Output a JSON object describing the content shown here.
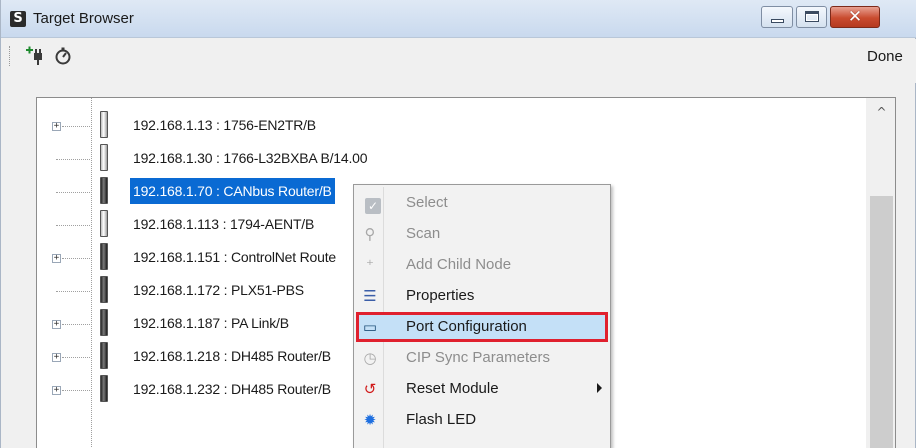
{
  "window": {
    "title": "Target Browser",
    "app_icon_glyph": "S",
    "close_glyph": "✕"
  },
  "toolbar": {
    "add_device_icon": "plug-add-icon",
    "refresh_icon": "refresh-icon",
    "done_label": "Done"
  },
  "tree": {
    "scroll_up_glyph": "^",
    "rows": [
      {
        "label": "192.168.1.13 : 1756-EN2TR/B",
        "expandable": true,
        "device_style": "light"
      },
      {
        "label": "192.168.1.30 : 1766-L32BXBA B/14.00",
        "expandable": false,
        "device_style": "light"
      },
      {
        "label": "192.168.1.70 : CANbus Router/B",
        "expandable": false,
        "device_style": "dark",
        "selected": true
      },
      {
        "label": "192.168.1.113 : 1794-AENT/B",
        "expandable": false,
        "device_style": "light"
      },
      {
        "label": "192.168.1.151 : ControlNet Route",
        "expandable": true,
        "device_style": "dark"
      },
      {
        "label": "192.168.1.172 : PLX51-PBS",
        "expandable": false,
        "device_style": "dark"
      },
      {
        "label": "192.168.1.187 : PA Link/B",
        "expandable": true,
        "device_style": "dark"
      },
      {
        "label": "192.168.1.218 : DH485 Router/B",
        "expandable": true,
        "device_style": "dark"
      },
      {
        "label": "192.168.1.232 : DH485 Router/B",
        "expandable": true,
        "device_style": "dark"
      }
    ]
  },
  "context_menu": {
    "items": [
      {
        "label": "Select",
        "icon": "checkmark-icon",
        "glyph": "✓",
        "enabled": false
      },
      {
        "label": "Scan",
        "icon": "magnifier-icon",
        "glyph": "⚲",
        "enabled": false
      },
      {
        "label": "Add Child Node",
        "icon": "add-node-icon",
        "glyph": "⁺",
        "enabled": false
      },
      {
        "label": "Properties",
        "icon": "list-icon",
        "glyph": "☰",
        "enabled": true
      },
      {
        "label": "Port Configuration",
        "icon": "monitor-icon",
        "glyph": "▭",
        "enabled": true,
        "highlighted": true
      },
      {
        "label": "CIP Sync Parameters",
        "icon": "stopwatch-icon",
        "glyph": "◷",
        "enabled": false
      },
      {
        "label": "Reset Module",
        "icon": "reset-icon",
        "glyph": "↺",
        "enabled": true,
        "submenu": true
      },
      {
        "label": "Flash LED",
        "icon": "flash-led-icon",
        "glyph": "✹",
        "enabled": true
      }
    ]
  },
  "colors": {
    "selection": "#0a6ad3",
    "highlight_bg": "#c4e0f7",
    "highlight_border": "#e0202e",
    "close_button": "#c94b2f"
  }
}
